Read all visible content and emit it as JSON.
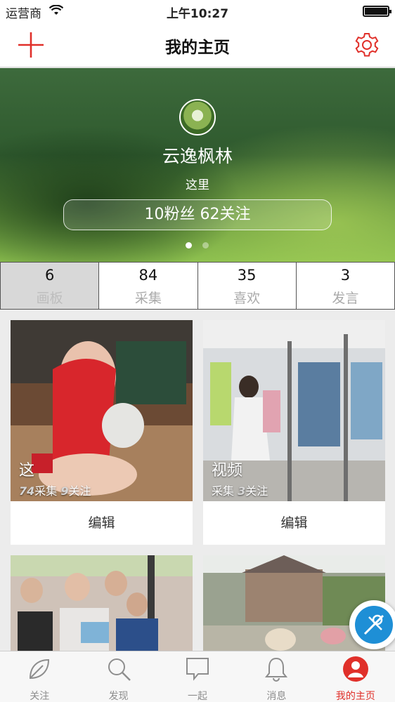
{
  "status_bar": {
    "carrier": "运营商",
    "time": "上午10:27",
    "battery_level": 1.0
  },
  "nav": {
    "title": "我的主页",
    "add_icon": "plus-icon",
    "settings_icon": "gear-icon",
    "accent_color": "#e0302a"
  },
  "profile": {
    "username": "云逸枫林",
    "bio": "这里",
    "follow_summary": "10粉丝 62关注",
    "page_dots": 2,
    "active_dot": 0
  },
  "stats": [
    {
      "count": "6",
      "label": "画板",
      "active": true
    },
    {
      "count": "84",
      "label": "采集"
    },
    {
      "count": "35",
      "label": "喜欢"
    },
    {
      "count": "3",
      "label": "发言"
    }
  ],
  "boards": [
    {
      "title": "这",
      "collect_count": "74",
      "collect_label": "采集",
      "follow_count": "9",
      "follow_label": "关注",
      "edit_label": "编辑"
    },
    {
      "title": "视频",
      "collect_count": "",
      "collect_label": "采集",
      "follow_count": "3",
      "follow_label": "关注",
      "edit_label": "编辑"
    },
    {
      "title": ""
    },
    {
      "title": ""
    }
  ],
  "tabs": [
    {
      "label": "关注",
      "icon": "leaf-icon"
    },
    {
      "label": "发现",
      "icon": "search-icon"
    },
    {
      "label": "一起",
      "icon": "chat-bubble-icon"
    },
    {
      "label": "消息",
      "icon": "bell-icon"
    },
    {
      "label": "我的主页",
      "icon": "person-icon",
      "active": true
    }
  ]
}
